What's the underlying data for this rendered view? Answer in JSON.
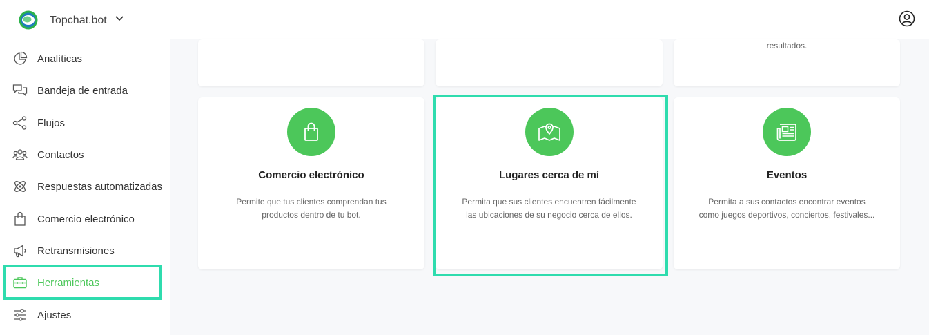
{
  "header": {
    "brand": "Topchat.bot"
  },
  "sidebar": {
    "items": [
      {
        "label": "Analíticas",
        "icon": "pie-chart-icon"
      },
      {
        "label": "Bandeja de entrada",
        "icon": "chat-bubbles-icon"
      },
      {
        "label": "Flujos",
        "icon": "flow-nodes-icon"
      },
      {
        "label": "Contactos",
        "icon": "users-icon"
      },
      {
        "label": "Respuestas automatizadas",
        "icon": "atom-icon"
      },
      {
        "label": "Comercio electrónico",
        "icon": "shopping-bag-icon"
      },
      {
        "label": "Retransmisiones",
        "icon": "megaphone-icon"
      },
      {
        "label": "Herramientas",
        "icon": "toolbox-icon",
        "active": true
      },
      {
        "label": "Ajustes",
        "icon": "sliders-icon"
      }
    ]
  },
  "top_cards": [
    {
      "text": ""
    },
    {
      "text": ""
    },
    {
      "text": "resultados."
    }
  ],
  "tools": [
    {
      "title": "Comercio electrónico",
      "description": "Permite que tus clientes comprendan tus productos dentro de tu bot.",
      "icon": "shopping-bag-icon"
    },
    {
      "title": "Lugares cerca de mí",
      "description": "Permita que sus clientes encuentren fácilmente las ubicaciones de su negocio cerca de ellos.",
      "icon": "map-pin-icon"
    },
    {
      "title": "Eventos",
      "description": "Permita a sus contactos encontrar eventos como juegos deportivos, conciertos, festivales...",
      "icon": "newspaper-icon"
    }
  ],
  "colors": {
    "accent": "#4cc75a",
    "highlight": "#2fdcae"
  }
}
